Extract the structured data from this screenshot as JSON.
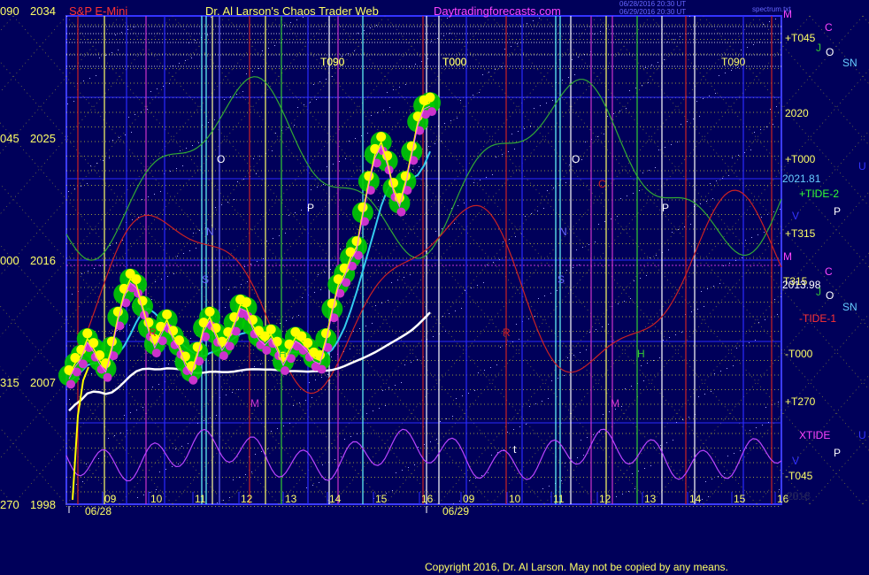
{
  "header": {
    "symbol": "S&P E-Mini",
    "author": "Dr. Al Larson's Chaos Trader Web",
    "site": "Daytradingforecasts.com",
    "stamp_line1": "06/28/2016 20:30 UT",
    "stamp_line2": "06/29/2016 20:30 UT",
    "stamp_right": "spectrum.txt",
    "left_top": "090",
    "price_top": "2034"
  },
  "footer": {
    "copyright": "Copyright 2016, Dr. Al Larson. May not be copied by any means."
  },
  "colors": {
    "background": "#00005a",
    "grid_blue": "#2a2aff",
    "border": "#3c3cff",
    "price_candle": "#ffff00",
    "highlight_green": "#00cc00",
    "magenta": "#cc33cc",
    "cyan_ma": "#33ccee",
    "white_ma": "#ffffff",
    "green_tide": "#33aa33",
    "red_tide": "#cc2222",
    "violet_xtide": "#bb44ff"
  },
  "chart_data": {
    "type": "line",
    "x_axis": {
      "ticks": [
        "09",
        "10",
        "11",
        "12",
        "13",
        "14",
        "15",
        "16",
        "09",
        "10",
        "11",
        "12",
        "13",
        "14",
        "15",
        "16"
      ],
      "dates": [
        "06/28",
        "06/29"
      ]
    },
    "y_axis": {
      "ylim": [
        1998,
        2034
      ],
      "price_ticks": [
        2034,
        2025,
        2016,
        2007,
        1998
      ],
      "left_labels": [
        "090",
        "045",
        "000",
        "315",
        "270"
      ]
    },
    "series": [
      {
        "x": [
          0,
          1,
          2,
          3,
          4,
          5,
          6,
          7,
          8,
          9,
          10,
          11,
          12,
          13,
          14,
          15,
          16,
          17,
          18,
          19,
          20,
          21,
          22,
          23,
          24,
          25,
          26,
          27,
          28,
          29,
          30,
          31,
          32,
          33,
          34,
          35,
          36,
          37,
          38,
          39,
          40,
          41,
          42,
          43,
          44,
          45,
          46,
          47,
          48,
          49,
          50,
          51,
          52,
          53,
          54,
          55,
          56,
          57,
          58,
          59
        ],
        "values": [
          2007.5,
          2008.4,
          2009.0,
          2010.2,
          2009.5,
          2008.6,
          2008.0,
          2009.6,
          2011.8,
          2013.5,
          2014.6,
          2014.2,
          2012.6,
          2011.0,
          2009.8,
          2010.7,
          2011.6,
          2010.4,
          2009.7,
          2008.5,
          2007.8,
          2009.2,
          2011.0,
          2011.8,
          2010.6,
          2009.6,
          2010.3,
          2011.4,
          2012.7,
          2012.5,
          2011.2,
          2010.4,
          2010.0,
          2010.5,
          2009.6,
          2008.5,
          2009.4,
          2010.3,
          2010.0,
          2009.5,
          2008.8,
          2008.6,
          2010.2,
          2012.4,
          2014.2,
          2015.0,
          2016.2,
          2017.0,
          2019.5,
          2021.8,
          2023.8,
          2024.7,
          2023.3,
          2021.3,
          2020.2,
          2021.8,
          2024.0,
          2026.2,
          2027.4,
          2027.6
        ]
      }
    ],
    "price_labels": [
      "2021.81",
      "2013.98",
      "2016"
    ],
    "right_labels": [
      "+T045",
      "T090",
      "T000",
      "+T000",
      "+TIDE-2",
      "+T315",
      "T315",
      "-TIDE-1",
      "-T000",
      "+T270",
      "XTIDE",
      "-T045",
      "2020",
      "2016",
      "2016"
    ],
    "right_letters": [
      "M",
      "C",
      "J",
      "O",
      "SN",
      "U",
      "V",
      "P",
      "M",
      "C",
      "J",
      "O",
      "SN",
      "U",
      "V",
      "P"
    ],
    "top_labels": [
      "T090",
      "T000",
      "T090"
    ],
    "in_chart_letters": [
      "O",
      "N",
      "P",
      "S",
      "H",
      "M",
      "R",
      "O",
      "C",
      "N",
      "S",
      "P",
      "R",
      "H",
      "M",
      "t"
    ]
  }
}
